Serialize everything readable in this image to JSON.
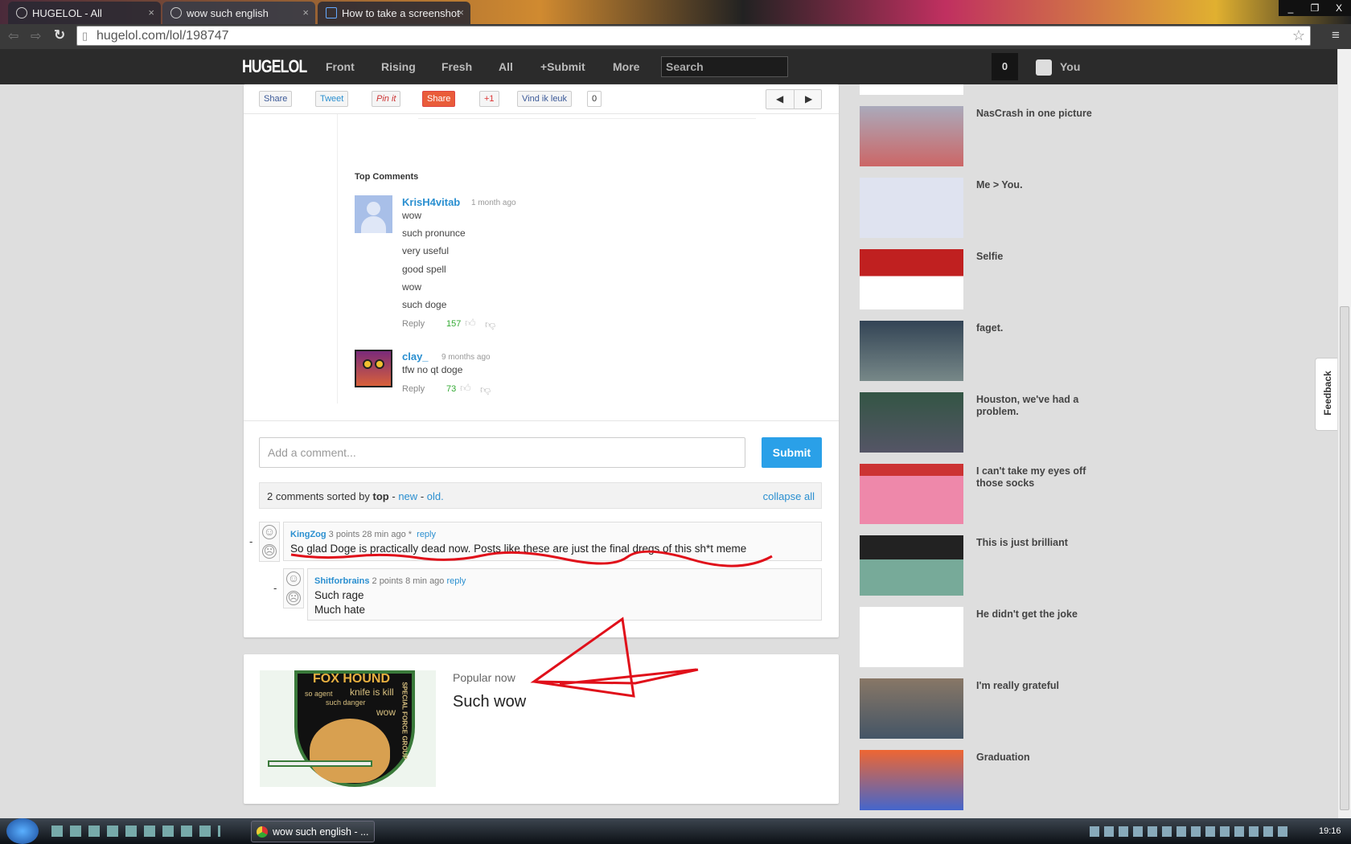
{
  "browser": {
    "tabs": [
      {
        "label": "HUGELOL - All"
      },
      {
        "label": "wow such english"
      },
      {
        "label": "How to take a screenshot"
      }
    ],
    "url": "hugelol.com/lol/198747",
    "window_controls": [
      "_",
      "❐",
      "X"
    ]
  },
  "nav": {
    "logo": "HUGELOL",
    "links": [
      "Front",
      "Rising",
      "Fresh",
      "All",
      "+Submit",
      "More"
    ],
    "search_placeholder": "Search",
    "notification_count": "0",
    "user_label": "You"
  },
  "share": {
    "buttons": [
      "Share",
      "Tweet",
      "Pin it",
      "Share",
      "+1",
      "Vind ik leuk"
    ],
    "like_count": "0"
  },
  "top_comments": {
    "heading": "Top Comments",
    "comments": [
      {
        "author": "KrisH4vitab",
        "time": "1 month ago",
        "lines": [
          "wow",
          "such pronunce",
          "very useful",
          "good spell",
          "wow",
          "such doge"
        ],
        "reply": "Reply",
        "score": "157"
      },
      {
        "author": "clay_",
        "time": "9 months ago",
        "lines": [
          "tfw no qt doge"
        ],
        "reply": "Reply",
        "score": "73"
      }
    ]
  },
  "comment_form": {
    "placeholder": "Add a comment...",
    "submit": "Submit"
  },
  "sort_bar": {
    "prefix": "2 comments sorted by",
    "top": "top",
    "sep": "-",
    "new": "new",
    "old": "old.",
    "collapse": "collapse all"
  },
  "comments": [
    {
      "author": "KingZog",
      "points": "3 points",
      "time": "28 min ago *",
      "reply": "reply",
      "text": [
        "So glad Doge is practically dead now. Posts like these are just the final dregs of this sh*t meme"
      ],
      "collapse": "-"
    },
    {
      "author": "Shitforbrains",
      "points": "2 points",
      "time": "8 min ago",
      "reply": "reply",
      "text": [
        "Such rage",
        "Much hate"
      ],
      "collapse": "-"
    }
  ],
  "popular": {
    "label": "Popular now",
    "title": "Such wow",
    "image_text": [
      "FOX HOUND",
      "so agent",
      "knife is kill",
      "such danger",
      "wow",
      "SPECIAL FORCE GROUP"
    ]
  },
  "sidebar": {
    "items": [
      "NasCrash in one picture",
      "Me > You.",
      "Selfie",
      "faget.",
      "Houston, we've had a problem.",
      "I can't take my eyes off those socks",
      "This is just brilliant",
      "He didn't get the joke",
      "I'm really grateful",
      "Graduation"
    ]
  },
  "feedback": "Feedback",
  "taskbar": {
    "window": "wow such english - ...",
    "clock": "19:16"
  },
  "colors": {
    "link": "#2a8fd0",
    "submit": "#2aa0e8",
    "annotation": "#e0101a",
    "score": "#33aa33"
  }
}
